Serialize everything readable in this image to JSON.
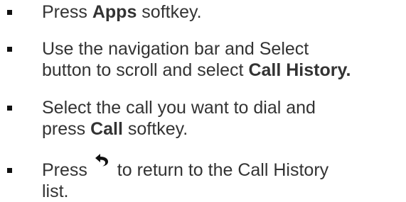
{
  "steps": [
    {
      "text_before": "Press ",
      "keyword": "Apps",
      "text_after": " softkey."
    },
    {
      "line1": "Use the navigation bar and Select",
      "line2_before": "button to scroll and select ",
      "keyword": "Call History."
    },
    {
      "line1": "Select the call you want to dial and",
      "line2_before": "press ",
      "keyword": "Call",
      "text_after": " softkey."
    },
    {
      "text_before": "Press ",
      "icon": "back-arrow-icon",
      "text_after": " to return to the Call History",
      "line2": "list."
    }
  ]
}
